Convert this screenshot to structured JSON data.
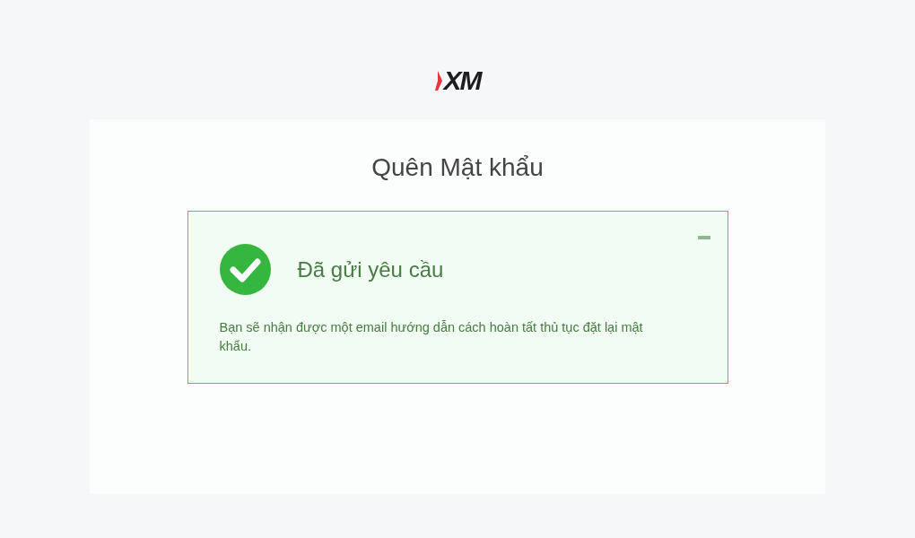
{
  "logo": {
    "text": "XM"
  },
  "title": "Quên Mật khẩu",
  "alert": {
    "kind": "success",
    "heading": "Đã gửi yêu cầu",
    "message": "Bạn sẽ nhận được một email hướng dẫn cách hoàn tất thủ tục đặt lại mật khẩu."
  }
}
